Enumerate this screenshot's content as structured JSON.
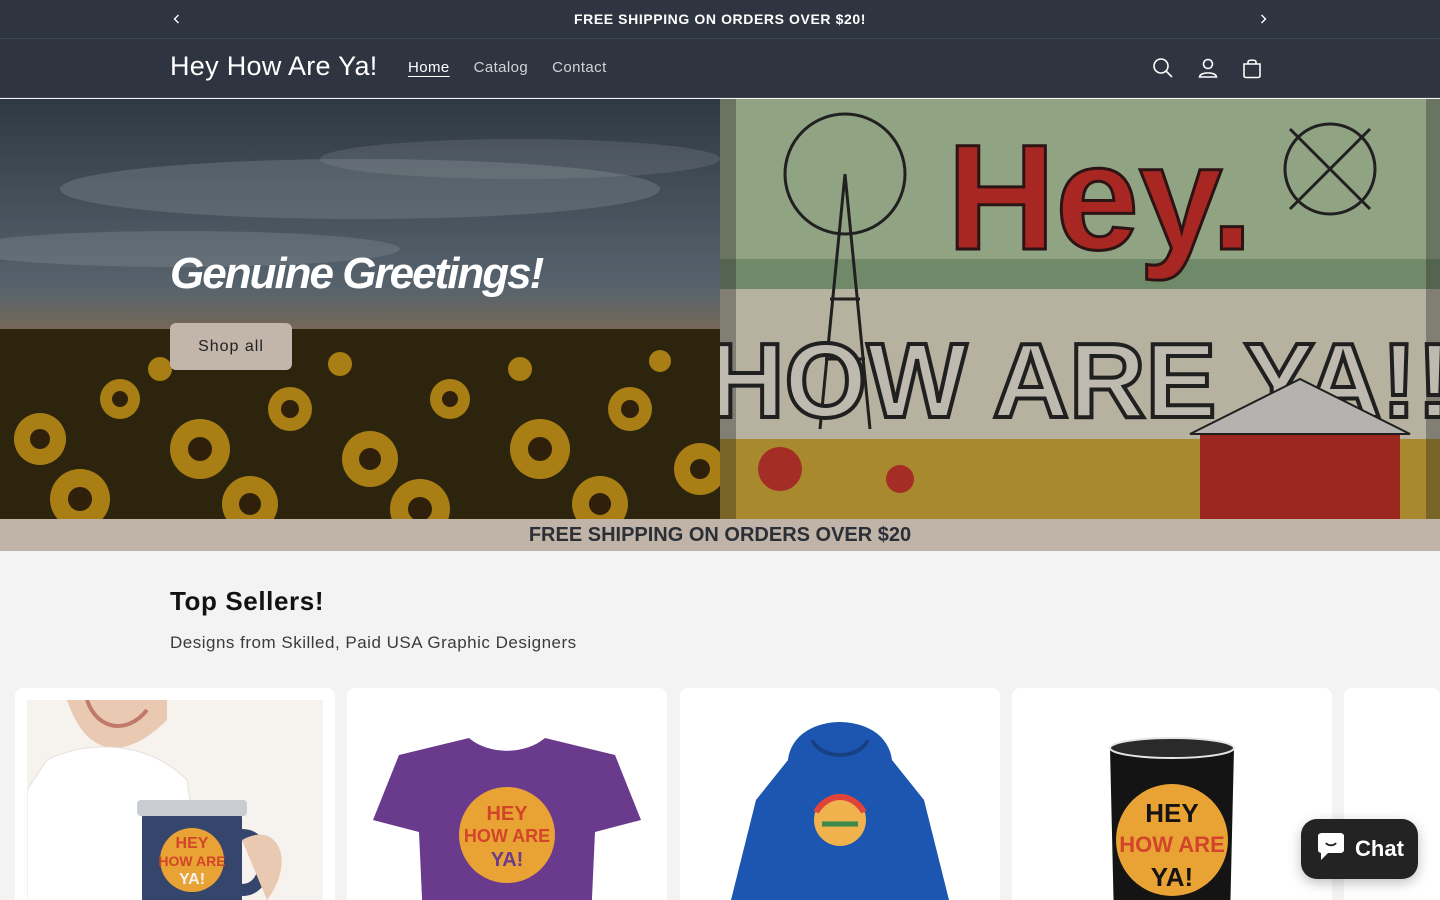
{
  "announcement": {
    "message": "FREE SHIPPING ON ORDERS OVER $20!",
    "prev_icon": "chevron-left-icon",
    "next_icon": "chevron-right-icon"
  },
  "header": {
    "logo": "Hey How Are Ya!",
    "nav": [
      {
        "label": "Home",
        "active": true
      },
      {
        "label": "Catalog",
        "active": false
      },
      {
        "label": "Contact",
        "active": false
      }
    ],
    "icons": [
      "search-icon",
      "account-icon",
      "cart-icon"
    ]
  },
  "hero": {
    "title": "Genuine Greetings!",
    "button": "Shop all",
    "banner_text_line1": "Hey.",
    "banner_text_line2": "HOW ARE YA!!"
  },
  "shipping_band": {
    "text": "FREE SHIPPING ON ORDERS OVER $20"
  },
  "top_sellers": {
    "title": "Top Sellers!",
    "subtitle": "Designs from Skilled, Paid USA Graphic Designers",
    "product_art_lines": [
      "HEY",
      "HOW ARE",
      "YA!"
    ]
  },
  "chat": {
    "label": "Chat",
    "icon": "chat-bubble-icon"
  },
  "colors": {
    "header_bg": "#2e3440",
    "accent_band": "#c0b3a8",
    "button_bg": "#c2b5aa",
    "page_bg": "#f3f3f3"
  }
}
